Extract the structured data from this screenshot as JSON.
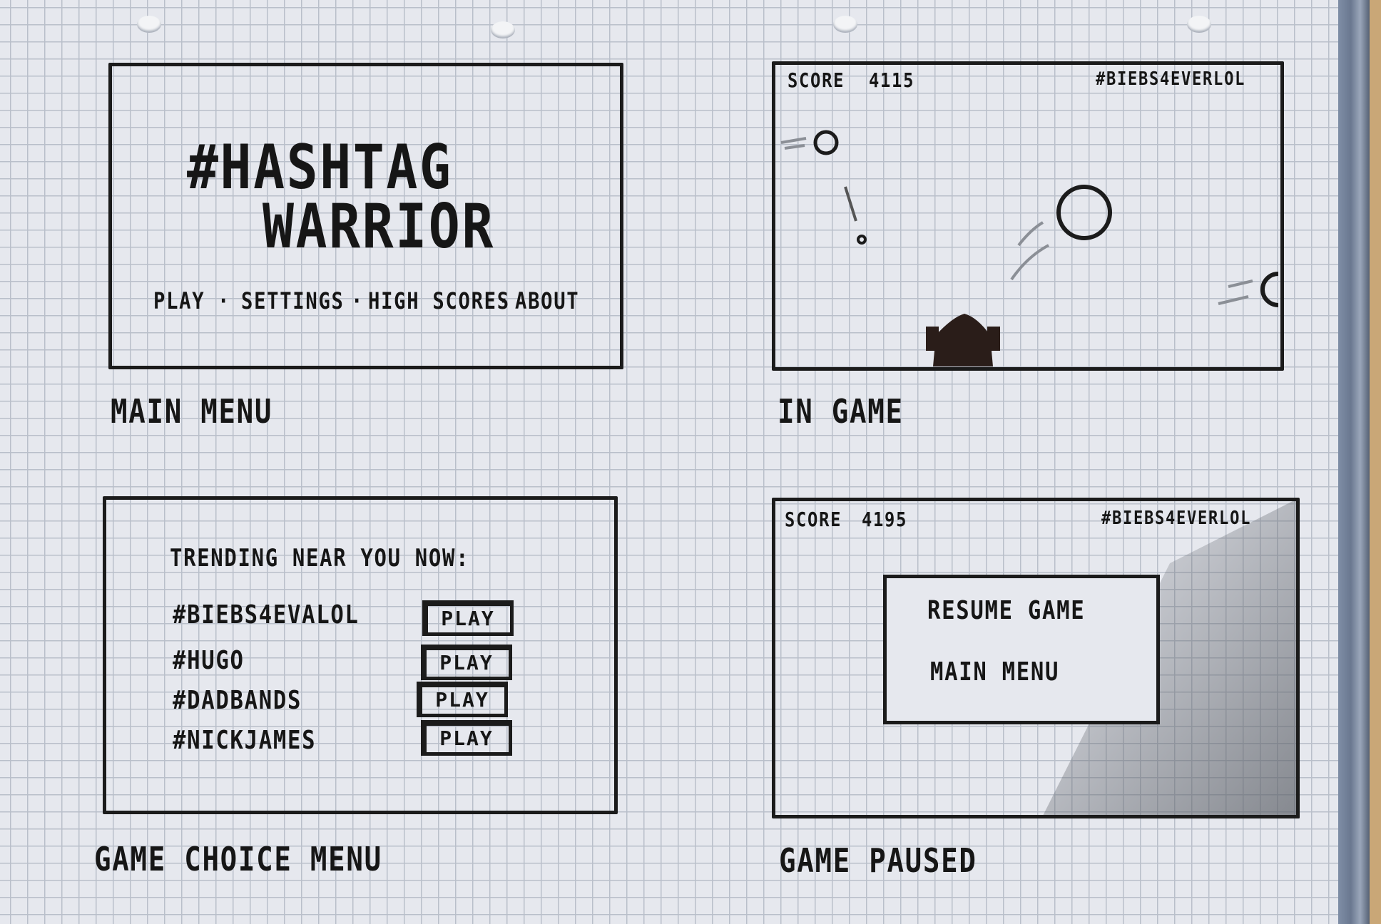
{
  "main_menu": {
    "caption": "MAIN MENU",
    "title_line1": "#HASHTAG",
    "title_line2": "WARRIOR",
    "nav": [
      "PLAY",
      "SETTINGS",
      "HIGH SCORES",
      "ABOUT"
    ],
    "separator": "·"
  },
  "in_game": {
    "caption": "IN GAME",
    "score_label": "SCORE",
    "score_value": "4115",
    "hashtag": "#BIEBS4EVERLOL"
  },
  "game_choice": {
    "caption": "GAME CHOICE MENU",
    "heading": "TRENDING NEAR YOU NOW:",
    "rows": [
      {
        "tag": "#BIEBS4EVALOL",
        "button": "PLAY"
      },
      {
        "tag": "#HUGO",
        "button": "PLAY"
      },
      {
        "tag": "#DADBANDS",
        "button": "PLAY"
      },
      {
        "tag": "#NICKJAMES",
        "button": "PLAY"
      }
    ]
  },
  "game_paused": {
    "caption": "GAME PAUSED",
    "score_label": "SCORE",
    "score_value": "4195",
    "hashtag": "#BIEBS4EVERLOL",
    "resume_label": "RESUME GAME",
    "main_menu_label": "MAIN MENU"
  }
}
